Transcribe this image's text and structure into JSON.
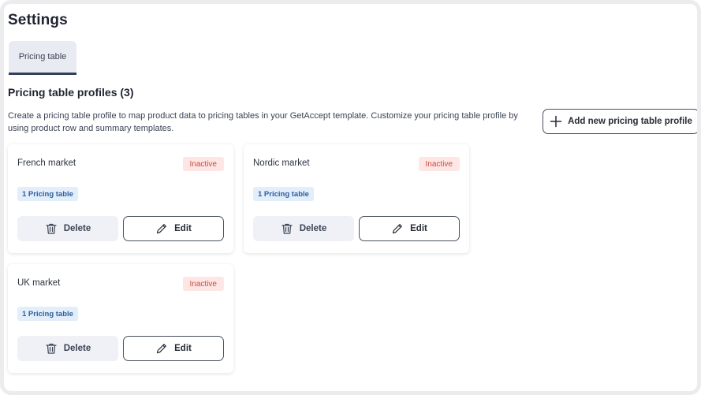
{
  "page": {
    "title": "Settings"
  },
  "tabs": [
    {
      "label": "Pricing table",
      "active": true
    }
  ],
  "section": {
    "title": "Pricing table profiles (3)",
    "description": "Create a pricing table profile to map product data to pricing tables in your GetAccept template. Customize your pricing table profile by using product row and summary templates.",
    "add_button_label": "Add new pricing table profile"
  },
  "profiles": [
    {
      "name": "French market",
      "status": "Inactive",
      "count_label": "1 Pricing table",
      "delete_label": "Delete",
      "edit_label": "Edit"
    },
    {
      "name": "Nordic market",
      "status": "Inactive",
      "count_label": "1 Pricing table",
      "delete_label": "Delete",
      "edit_label": "Edit"
    },
    {
      "name": "UK market",
      "status": "Inactive",
      "count_label": "1 Pricing table",
      "delete_label": "Delete",
      "edit_label": "Edit"
    }
  ],
  "icons": {
    "add": "plus-icon",
    "delete": "trash-icon",
    "edit": "pencil-icon"
  },
  "colors": {
    "inactive_text": "#d4473b",
    "inactive_bg": "#fde6e4",
    "count_text": "#2d5f9c",
    "count_bg": "#e3eefb",
    "tab_underline": "#33405a"
  }
}
